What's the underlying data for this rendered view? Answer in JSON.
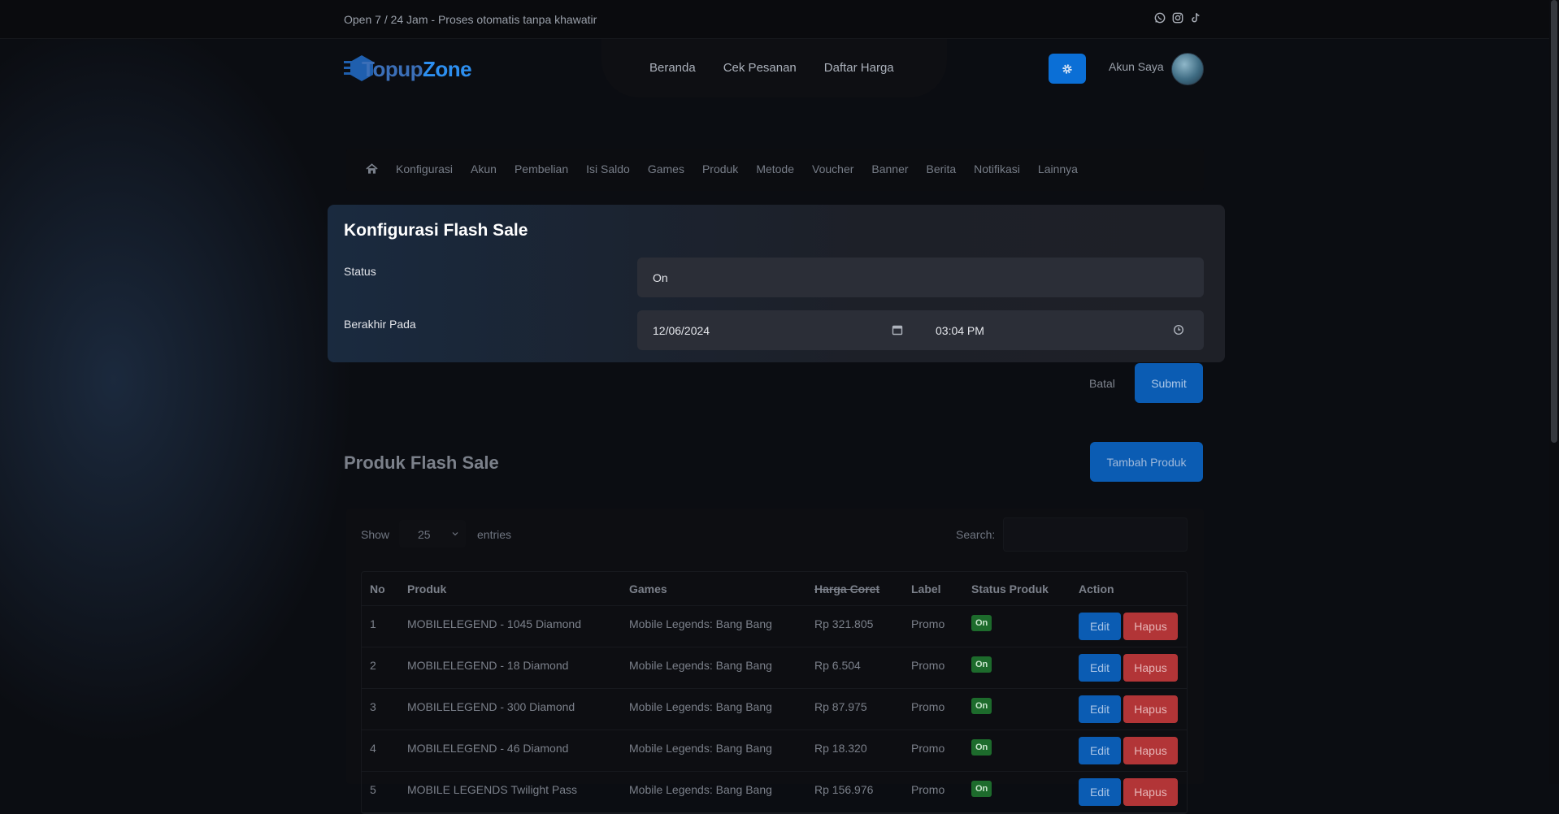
{
  "topbar": {
    "tagline": "Open 7 / 24 Jam - Proses otomatis tanpa khawatir",
    "socials": [
      "whatsapp-icon",
      "instagram-icon",
      "tiktok-icon"
    ]
  },
  "brand": {
    "part1": "Topup",
    "part2": "Zone",
    "accent": "#2d8ff0"
  },
  "nav": [
    "Beranda",
    "Cek Pesanan",
    "Daftar Harga"
  ],
  "account": {
    "label": "Akun Saya"
  },
  "subnav": [
    "Konfigurasi",
    "Akun",
    "Pembelian",
    "Isi Saldo",
    "Games",
    "Produk",
    "Metode",
    "Voucher",
    "Banner",
    "Berita",
    "Notifikasi",
    "Lainnya"
  ],
  "config": {
    "title": "Konfigurasi Flash Sale",
    "status_label": "Status",
    "status_value": "On",
    "end_label": "Berakhir Pada",
    "end_date": "12/06/2024",
    "end_time": "03:04 PM",
    "cancel": "Batal",
    "submit": "Submit"
  },
  "products": {
    "title": "Produk Flash Sale",
    "add_button": "Tambah Produk",
    "show_label": "Show",
    "page_length": "25",
    "entries_label": "entries",
    "search_label": "Search:",
    "columns": [
      "No",
      "Produk",
      "Games",
      "Harga Coret",
      "Label",
      "Status Produk",
      "Action"
    ],
    "rows": [
      {
        "no": "1",
        "produk": "MOBILELEGEND - 1045 Diamond",
        "games": "Mobile Legends: Bang Bang",
        "harga": "Rp 321.805",
        "label": "Promo",
        "status": "On",
        "edit": "Edit",
        "hapus": "Hapus"
      },
      {
        "no": "2",
        "produk": "MOBILELEGEND - 18 Diamond",
        "games": "Mobile Legends: Bang Bang",
        "harga": "Rp 6.504",
        "label": "Promo",
        "status": "On",
        "edit": "Edit",
        "hapus": "Hapus"
      },
      {
        "no": "3",
        "produk": "MOBILELEGEND - 300 Diamond",
        "games": "Mobile Legends: Bang Bang",
        "harga": "Rp 87.975",
        "label": "Promo",
        "status": "On",
        "edit": "Edit",
        "hapus": "Hapus"
      },
      {
        "no": "4",
        "produk": "MOBILELEGEND - 46 Diamond",
        "games": "Mobile Legends: Bang Bang",
        "harga": "Rp 18.320",
        "label": "Promo",
        "status": "On",
        "edit": "Edit",
        "hapus": "Hapus"
      },
      {
        "no": "5",
        "produk": "MOBILE LEGENDS Twilight Pass",
        "games": "Mobile Legends: Bang Bang",
        "harga": "Rp 156.976",
        "label": "Promo",
        "status": "On",
        "edit": "Edit",
        "hapus": "Hapus"
      }
    ]
  }
}
